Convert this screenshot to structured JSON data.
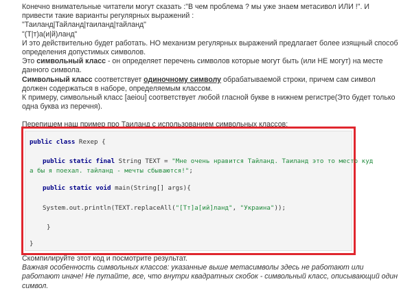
{
  "intro": {
    "line1": "Конечно внимательные читатели могут сказать :\"В чем проблема ? мы уже знаем метасивол ИЛИ !\". И",
    "line2": "привести такие варианты регулярных выражений :",
    "line3": "\"Таиланд|Тайланд|таиланд|тайланд\"",
    "line4": "\"(Т|т)а(и|й)ланд\"",
    "line5": "И это действительно будет работать. НО механизм регулярных выражений предлагает более изящный способ",
    "line6": "определения допустимых символов.",
    "line7_pre": "Это ",
    "line7_bold": "символьный класс",
    "line7_post": " - он определяет перечень символов которые могут быть (или НЕ могут) на месте",
    "line8": "данного символа.",
    "line9_bold": "Символьный класс",
    "line9_mid": " соответствует ",
    "line9_underline": "одиночному символу",
    "line9_post": " обрабатываемой строки, причем сам символ",
    "line10": "должен содержаться в наборе, определяемым классом.",
    "line11": "К примеру, символьный класс [aeiou] соответствует любой гласной букве в нижнем регистре(Это будет только",
    "line12": "одна буква из перечня).",
    "line13": "Перепишем наш пример про Таиланд с использованием символьных классов:"
  },
  "code": {
    "l1_kw": "public class",
    "l1_rest": " Rexep {",
    "l2_kw": "public static final",
    "l2_type": " String TEXT = ",
    "l2_str": "\"Мне очень нравится Тайланд. Таиланд это то место куд",
    "l3_str": "а бы я поехал. тайланд - мечты сбываются!\"",
    "l3_rest": ";",
    "l4_kw": "public static void",
    "l4_rest": " main(String[] args){",
    "l5_pre": "System.out.println(TEXT.replaceAll(",
    "l5_str1": "\"[Тт]а[ий]ланд\"",
    "l5_mid": ", ",
    "l5_str2": "\"Украина\"",
    "l5_post": "));",
    "l6": "}",
    "l7": "}"
  },
  "outro": {
    "line1": "Скомпилируйте этот код и посмотрите результат.",
    "line2": "Важная особенность символьных классов: указанные выше метасимволы здесь не работают или",
    "line3": "работают иначе! Не путайте, все, что внутри квадратных скобок - символьный класс, описывающий один",
    "line4": "символ."
  },
  "colors": {
    "highlight_border": "#e0262e",
    "code_background": "#f4f4f4",
    "keyword": "#000088",
    "string": "#1f8a3b"
  }
}
